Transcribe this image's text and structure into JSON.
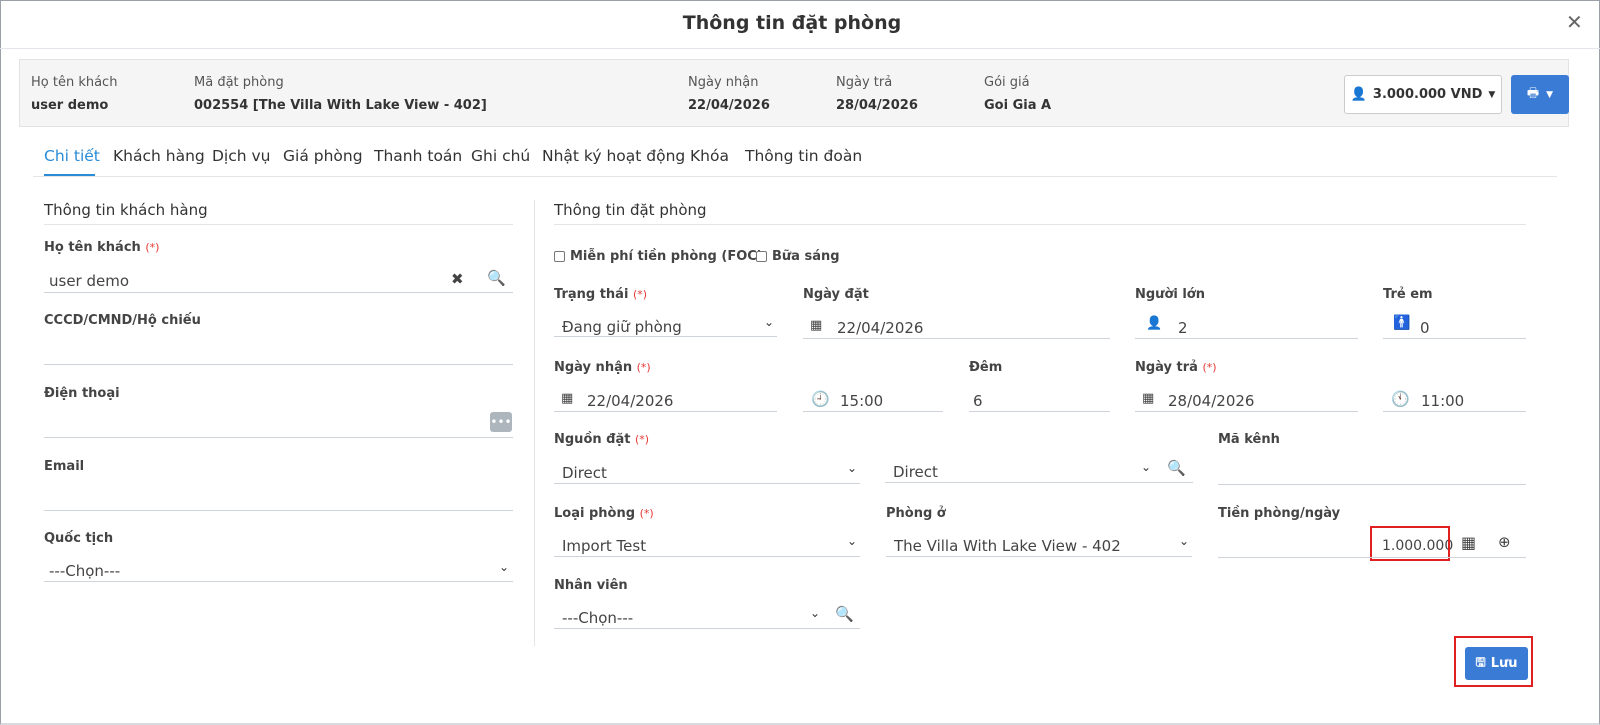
{
  "dialog": {
    "title": "Thông tin đặt phòng"
  },
  "summary": {
    "guest_label": "Họ tên khách",
    "guest_value": "user demo",
    "code_label": "Mã đặt phòng",
    "code_value": "002554 [The Villa With Lake View - 402]",
    "checkin_label": "Ngày nhận",
    "checkin_value": "22/04/2026",
    "checkout_label": "Ngày trả",
    "checkout_value": "28/04/2026",
    "rate_label": "Gói giá",
    "rate_value": "Goi Gia A",
    "price_button": "3.000.000 VND"
  },
  "tabs": [
    {
      "label": "Chi tiết"
    },
    {
      "label": "Khách hàng"
    },
    {
      "label": "Dịch vụ"
    },
    {
      "label": "Giá phòng"
    },
    {
      "label": "Thanh toán"
    },
    {
      "label": "Ghi chú"
    },
    {
      "label": "Nhật ký hoạt động"
    },
    {
      "label": "Khóa"
    },
    {
      "label": "Thông tin đoàn"
    }
  ],
  "customer": {
    "section_title": "Thông tin khách hàng",
    "name_label": "Họ tên khách",
    "name_value": "user demo",
    "id_label": "CCCD/CMND/Hộ chiếu",
    "phone_label": "Điện thoại",
    "email_label": "Email",
    "nationality_label": "Quốc tịch",
    "nationality_value": "---Chọn---"
  },
  "booking": {
    "section_title": "Thông tin đặt phòng",
    "foc_label": "Miễn phí tiền phòng (FOC)",
    "breakfast_label": "Bữa sáng",
    "status_label": "Trạng thái",
    "status_value": "Đang giữ phòng",
    "booking_date_label": "Ngày đặt",
    "booking_date_value": "22/04/2026",
    "adults_label": "Người lớn",
    "adults_value": "2",
    "children_label": "Trẻ em",
    "children_value": "0",
    "checkin_label": "Ngày nhận",
    "checkin_date": "22/04/2026",
    "checkin_time": "15:00",
    "nights_label": "Đêm",
    "nights_value": "6",
    "checkout_label": "Ngày trả",
    "checkout_date": "28/04/2026",
    "checkout_time": "11:00",
    "source_label": "Nguồn đặt",
    "source_value": "Direct",
    "source_value2": "Direct",
    "channel_label": "Mã kênh",
    "room_type_label": "Loại phòng",
    "room_type_value": "Import Test",
    "room_label": "Phòng ở",
    "room_value": "The Villa With Lake View - 402",
    "price_label": "Tiền phòng/ngày",
    "price_value": "1.000.000",
    "staff_label": "Nhân viên",
    "staff_value": "---Chọn---",
    "required_mark": "(*)"
  },
  "save_label": "Lưu",
  "colors": {
    "primary": "#3a7bd5",
    "tab_active": "#2a8bd6",
    "required": "#e53935",
    "highlight": "#e02020"
  }
}
